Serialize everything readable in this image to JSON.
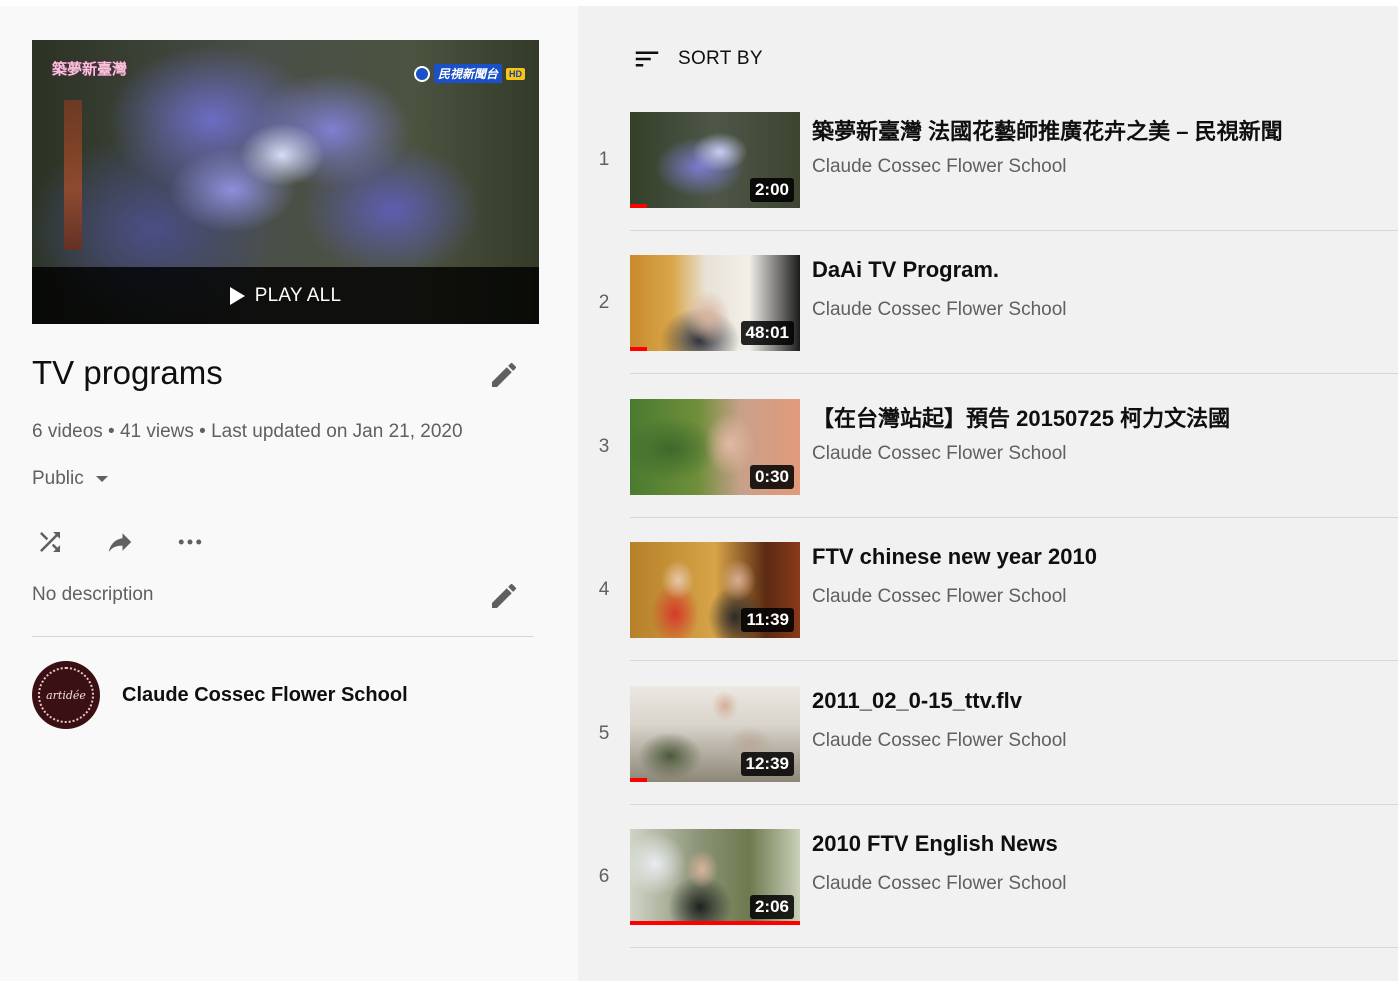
{
  "playlist": {
    "title": "TV programs",
    "play_all_label": "PLAY ALL",
    "stats": "6 videos • 41 views • Last updated on Jan 21, 2020",
    "privacy": "Public",
    "description": "No description",
    "owner_name": "Claude Cossec Flower School",
    "owner_avatar_text": "artidée"
  },
  "hero": {
    "logo_text": "築夢新臺灣",
    "channel_text": "民視新聞台",
    "hd_badge": "HD"
  },
  "sort": {
    "label": "SORT BY"
  },
  "videos": [
    {
      "index": "1",
      "title": "築夢新臺灣 法國花藝師推廣花卉之美 – 民視新聞",
      "channel": "Claude Cossec Flower School",
      "duration": "2:00",
      "watched_fraction": 0.1
    },
    {
      "index": "2",
      "title": "DaAi TV Program.",
      "channel": "Claude Cossec Flower School",
      "duration": "48:01",
      "watched_fraction": 0.1
    },
    {
      "index": "3",
      "title": "【在台灣站起】預告 20150725 柯力文法國",
      "channel": "Claude Cossec Flower School",
      "duration": "0:30",
      "watched_fraction": 0
    },
    {
      "index": "4",
      "title": "FTV chinese new year 2010",
      "channel": "Claude Cossec Flower School",
      "duration": "11:39",
      "watched_fraction": 0
    },
    {
      "index": "5",
      "title": "2011_02_0-15_ttv.flv",
      "channel": "Claude Cossec Flower School",
      "duration": "12:39",
      "watched_fraction": 0.1
    },
    {
      "index": "6",
      "title": "2010 FTV English News",
      "channel": "Claude Cossec Flower School",
      "duration": "2:06",
      "watched_fraction": 1.0
    }
  ],
  "icons": {
    "edit": "pencil-icon",
    "shuffle": "shuffle-icon",
    "share": "share-icon",
    "more": "more-horiz-icon",
    "sort": "sort-icon",
    "play": "play-icon",
    "dropdown": "caret-down-icon"
  },
  "colors": {
    "progress": "#ff0000",
    "sidebar_bg": "#f9f9f9",
    "list_bg": "#f1f1f1",
    "secondary_text": "#606060"
  }
}
